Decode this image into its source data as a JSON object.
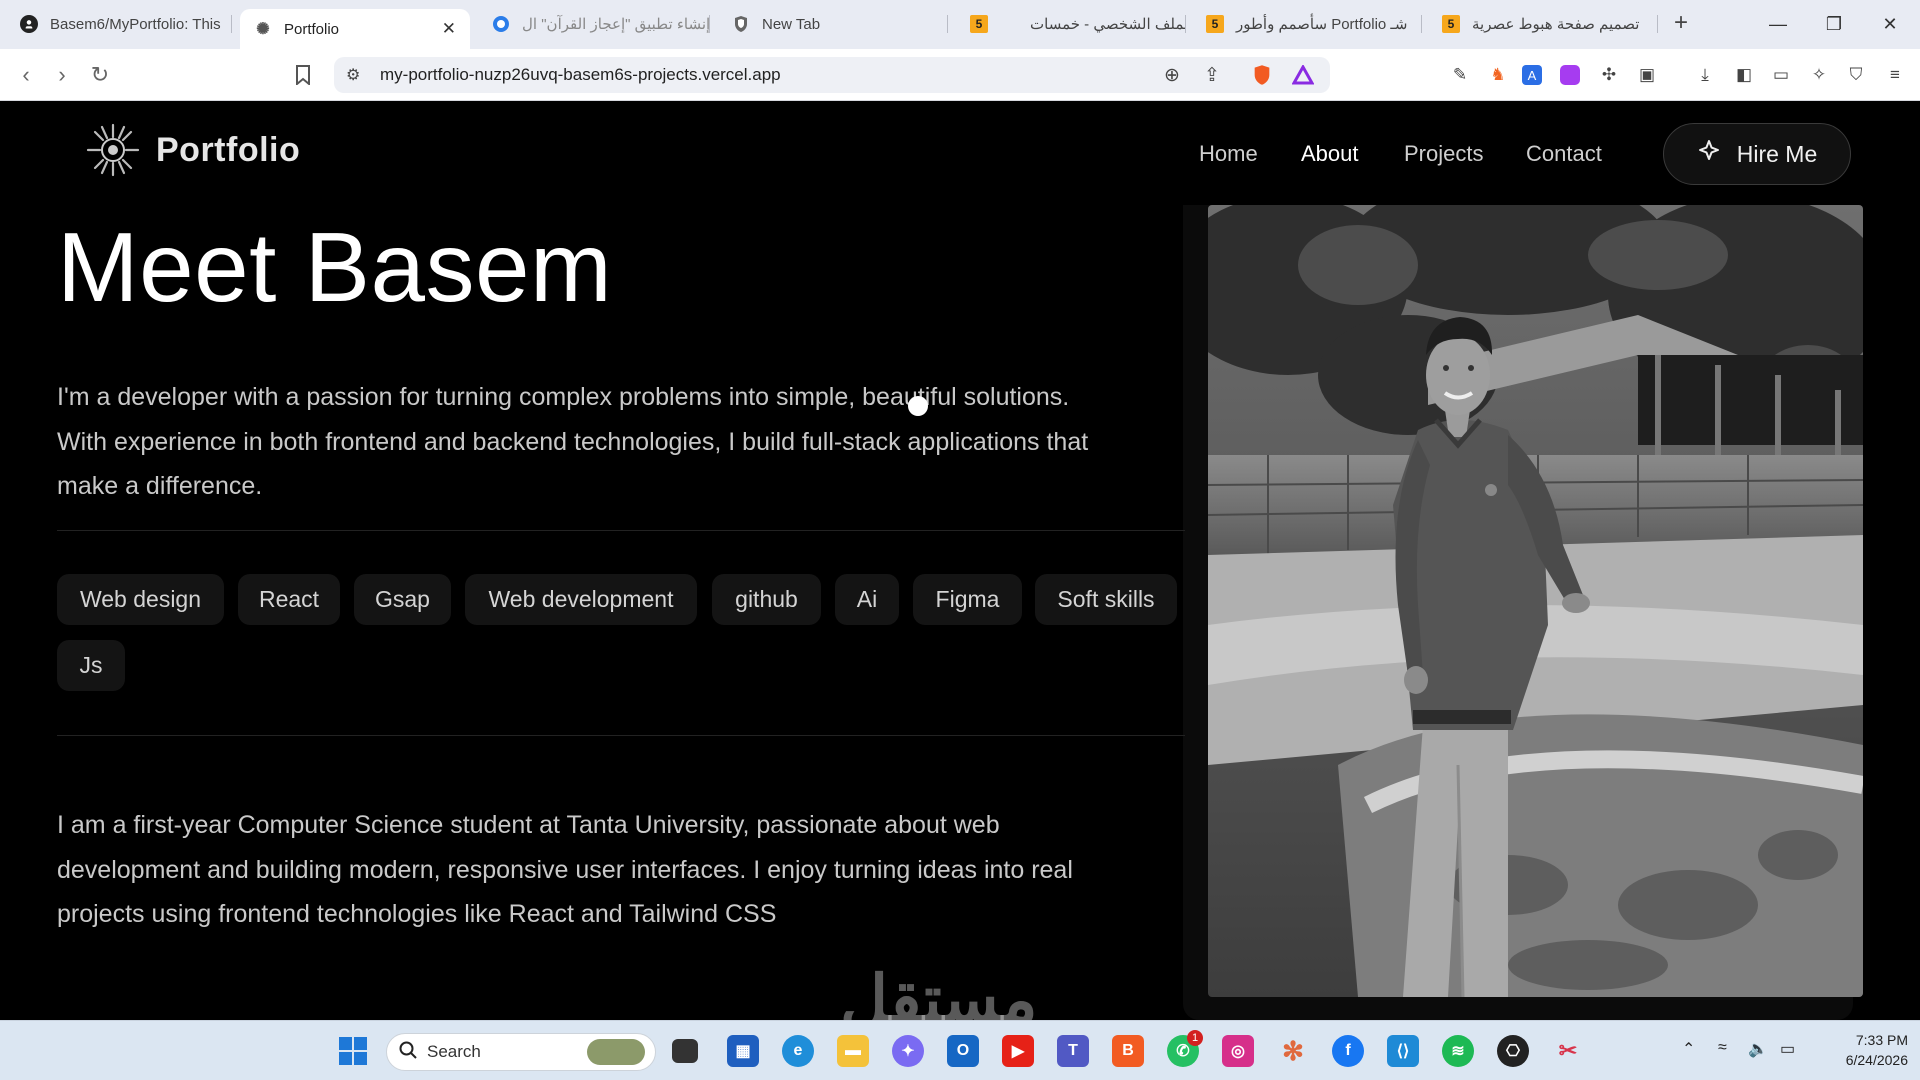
{
  "browser": {
    "tabs": [
      {
        "title": "Basem6/MyPortfolio: This",
        "icon": "github-icon"
      },
      {
        "title": "Portfolio",
        "icon": "sun-icon",
        "active": true
      },
      {
        "title": "إنشاء تطبيق \"إعجاز القرآن\" ال",
        "icon": "circle-icon"
      },
      {
        "title": "New Tab",
        "icon": "brave-icon"
      },
      {
        "title": "الملف الشخصي - خمسات",
        "icon": "khamsat-icon",
        "badge": "5"
      },
      {
        "title": "سأصمم وأطور Portfolio شـ",
        "icon": "khamsat-icon",
        "badge": "5"
      },
      {
        "title": "تصميم صفحة هبوط عصرية",
        "icon": "khamsat-icon",
        "badge": "5"
      }
    ],
    "close_glyph": "✕",
    "url": "my-portfolio-nuzp26uvq-basem6s-projects.vercel.app"
  },
  "site": {
    "logo_text": "Portfolio",
    "nav": [
      "Home",
      "About",
      "Projects",
      "Contact"
    ],
    "active_nav": "About",
    "hire_label": "Hire Me",
    "heading": "Meet Basem",
    "intro_lines": [
      "I'm a developer with a passion for turning complex problems into simple, beautiful solutions.",
      "With experience in both frontend and backend technologies, I build full-stack applications that",
      "make a difference."
    ],
    "skills": [
      "Web design",
      "React",
      "Gsap",
      "Web development",
      "github",
      "Ai",
      "Figma",
      "Soft skills",
      "Js"
    ],
    "bio_lines": [
      "I am a first-year Computer Science student at Tanta University, passionate about web",
      "development and building modern, responsive user interfaces. I enjoy turning ideas into real",
      "projects using frontend technologies like React and Tailwind CSS"
    ],
    "watermark": "مستقل"
  },
  "taskbar": {
    "search_label": "Search",
    "whatsapp_badge": "1",
    "time": "7:33 PM",
    "date": "6/24/2026"
  }
}
